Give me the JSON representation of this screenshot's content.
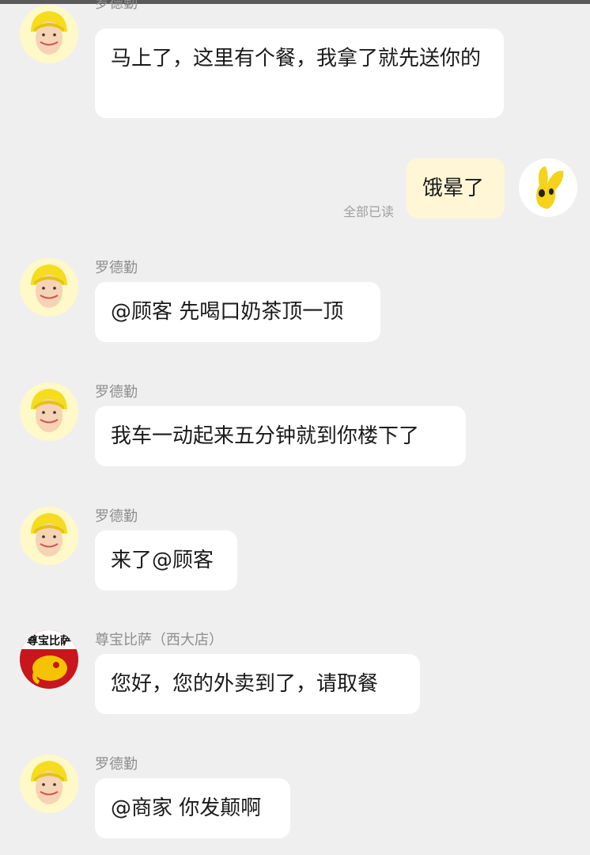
{
  "colors": {
    "background": "#efefef",
    "bubble": "#ffffff",
    "my_bubble": "#fff6d6",
    "rider_helmet": "#f5dc1e",
    "rider_bg": "#fff8c8"
  },
  "messages": [
    {
      "side": "left",
      "sender": "罗德勤",
      "avatar": "rider-avatar-icon",
      "text": "马上了，这里有个餐，我拿了就先送你的"
    },
    {
      "side": "right",
      "avatar": "user-avatar-icon",
      "text": "饿晕了",
      "status": "全部已读"
    },
    {
      "side": "left",
      "sender": "罗德勤",
      "avatar": "rider-avatar-icon",
      "text": "@顾客 先喝口奶茶顶一顶"
    },
    {
      "side": "left",
      "sender": "罗德勤",
      "avatar": "rider-avatar-icon",
      "text": "我车一动起来五分钟就到你楼下了"
    },
    {
      "side": "left",
      "sender": "罗德勤",
      "avatar": "rider-avatar-icon",
      "text": "来了@顾客"
    },
    {
      "side": "left",
      "sender": "尊宝比萨（西大店）",
      "avatar": "shop-logo-icon",
      "avatar_text": "尊宝比萨",
      "text": "您好，您的外卖到了，请取餐"
    },
    {
      "side": "left",
      "sender": "罗德勤",
      "avatar": "rider-avatar-icon",
      "text": "@商家 你发颠啊"
    }
  ]
}
